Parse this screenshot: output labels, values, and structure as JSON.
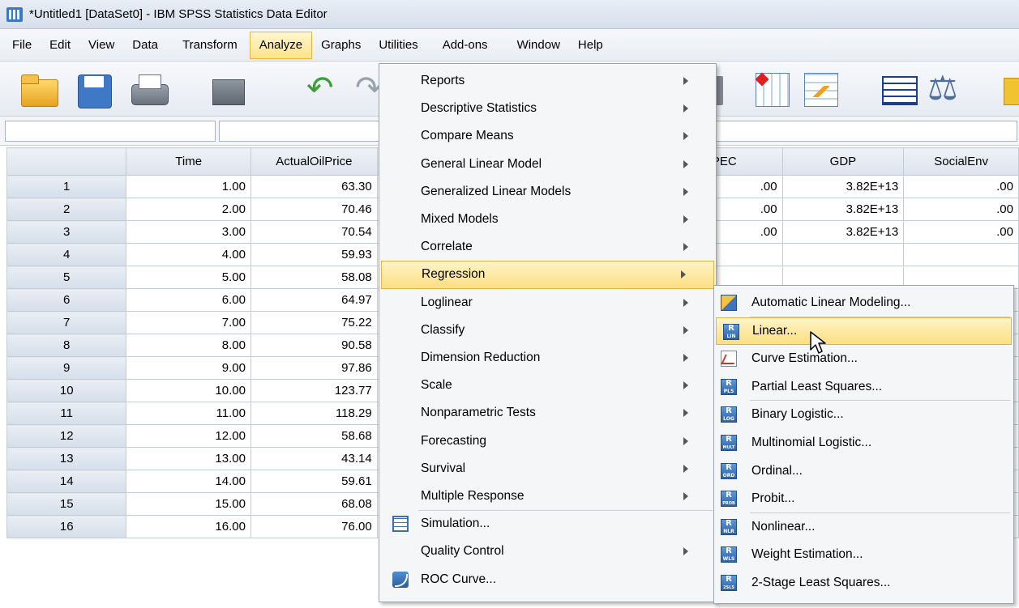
{
  "window": {
    "title": "*Untitled1 [DataSet0] - IBM SPSS Statistics Data Editor"
  },
  "menubar": [
    {
      "id": "file",
      "label": "File"
    },
    {
      "id": "edit",
      "label": "Edit"
    },
    {
      "id": "view",
      "label": "View"
    },
    {
      "id": "data",
      "label": "Data"
    },
    {
      "id": "transform",
      "label": "Transform"
    },
    {
      "id": "analyze",
      "label": "Analyze"
    },
    {
      "id": "graphs",
      "label": "Graphs"
    },
    {
      "id": "utilities",
      "label": "Utilities"
    },
    {
      "id": "addons",
      "label": "Add-ons"
    },
    {
      "id": "window",
      "label": "Window"
    },
    {
      "id": "help",
      "label": "Help"
    }
  ],
  "grid": {
    "columns": [
      "Time",
      "ActualOilPrice",
      "PEC",
      "GDP",
      "SocialEnv"
    ],
    "rows": [
      {
        "n": "1",
        "time": "1.00",
        "price": "63.30",
        "pec": ".00",
        "gdp": "3.82E+13",
        "env": ".00"
      },
      {
        "n": "2",
        "time": "2.00",
        "price": "70.46",
        "pec": ".00",
        "gdp": "3.82E+13",
        "env": ".00"
      },
      {
        "n": "3",
        "time": "3.00",
        "price": "70.54",
        "pec": ".00",
        "gdp": "3.82E+13",
        "env": ".00"
      },
      {
        "n": "4",
        "time": "4.00",
        "price": "59.93"
      },
      {
        "n": "5",
        "time": "5.00",
        "price": "58.08"
      },
      {
        "n": "6",
        "time": "6.00",
        "price": "64.97"
      },
      {
        "n": "7",
        "time": "7.00",
        "price": "75.22"
      },
      {
        "n": "8",
        "time": "8.00",
        "price": "90.58"
      },
      {
        "n": "9",
        "time": "9.00",
        "price": "97.86"
      },
      {
        "n": "10",
        "time": "10.00",
        "price": "123.77"
      },
      {
        "n": "11",
        "time": "11.00",
        "price": "118.29"
      },
      {
        "n": "12",
        "time": "12.00",
        "price": "58.68"
      },
      {
        "n": "13",
        "time": "13.00",
        "price": "43.14"
      },
      {
        "n": "14",
        "time": "14.00",
        "price": "59.61"
      },
      {
        "n": "15",
        "time": "15.00",
        "price": "68.08"
      },
      {
        "n": "16",
        "time": "16.00",
        "price": "76.00"
      }
    ]
  },
  "analyze_menu": {
    "items": [
      {
        "label": "Reports",
        "submenu": true,
        "icon": ""
      },
      {
        "label": "Descriptive Statistics",
        "submenu": true,
        "icon": ""
      },
      {
        "label": "Compare Means",
        "submenu": true,
        "icon": ""
      },
      {
        "label": "General Linear Model",
        "submenu": true,
        "icon": ""
      },
      {
        "label": "Generalized Linear Models",
        "submenu": true,
        "icon": ""
      },
      {
        "label": "Mixed Models",
        "submenu": true,
        "icon": ""
      },
      {
        "label": "Correlate",
        "submenu": true,
        "icon": ""
      },
      {
        "label": "Regression",
        "submenu": true,
        "icon": "",
        "highlighted": true
      },
      {
        "label": "Loglinear",
        "submenu": true,
        "icon": ""
      },
      {
        "label": "Classify",
        "submenu": true,
        "icon": ""
      },
      {
        "label": "Dimension Reduction",
        "submenu": true,
        "icon": ""
      },
      {
        "label": "Scale",
        "submenu": true,
        "icon": ""
      },
      {
        "label": "Nonparametric Tests",
        "submenu": true,
        "icon": ""
      },
      {
        "label": "Forecasting",
        "submenu": true,
        "icon": ""
      },
      {
        "label": "Survival",
        "submenu": true,
        "icon": ""
      },
      {
        "label": "Multiple Response",
        "submenu": true,
        "icon": ""
      },
      {
        "label": "Simulation...",
        "submenu": false,
        "icon": "simulation-icon"
      },
      {
        "label": "Quality Control",
        "submenu": true,
        "icon": ""
      },
      {
        "label": "ROC Curve...",
        "submenu": false,
        "icon": "roc-curve-icon"
      }
    ]
  },
  "regression_menu": {
    "items": [
      {
        "label": "Automatic Linear Modeling...",
        "badge": "",
        "icon": "automatic-linear-modeling-icon"
      },
      {
        "label": "Linear...",
        "badge": "LIN",
        "icon": "linear-regression-icon",
        "highlighted": true
      },
      {
        "label": "Curve Estimation...",
        "badge": "",
        "icon": "curve-estimation-icon"
      },
      {
        "label": "Partial Least Squares...",
        "badge": "PLS",
        "icon": "partial-least-squares-icon"
      },
      {
        "label": "Binary Logistic...",
        "badge": "LOG",
        "icon": "binary-logistic-icon"
      },
      {
        "label": "Multinomial Logistic...",
        "badge": "MULT",
        "icon": "multinomial-logistic-icon"
      },
      {
        "label": "Ordinal...",
        "badge": "ORD",
        "icon": "ordinal-regression-icon"
      },
      {
        "label": "Probit...",
        "badge": "PROB",
        "icon": "probit-icon"
      },
      {
        "label": "Nonlinear...",
        "badge": "NLR",
        "icon": "nonlinear-regression-icon"
      },
      {
        "label": "Weight Estimation...",
        "badge": "WLS",
        "icon": "weight-estimation-icon"
      },
      {
        "label": "2-Stage Least Squares...",
        "badge": "2SLS",
        "icon": "two-stage-least-squares-icon"
      }
    ]
  },
  "colors": {
    "highlight": "#fcdf80",
    "menu_bg": "#f5f6f8",
    "header_bg": "#dde4ed"
  }
}
